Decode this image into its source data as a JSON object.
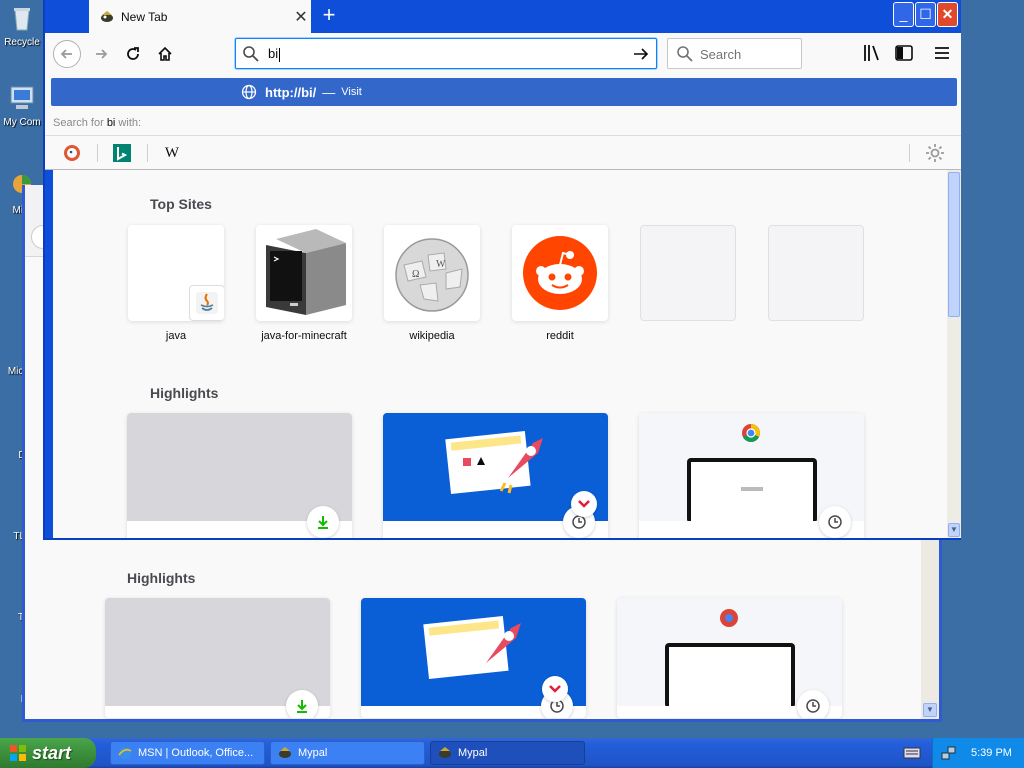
{
  "desktop": {
    "icons": [
      {
        "label": "Recycle"
      },
      {
        "label": "My Com"
      },
      {
        "label": "Micr"
      },
      {
        "label": "Micr E"
      },
      {
        "label": "D"
      },
      {
        "label": "TLa"
      },
      {
        "label": "Tl"
      },
      {
        "label": "I"
      }
    ]
  },
  "browser": {
    "tab_title": "New Tab",
    "url_value": "bi",
    "search_placeholder": "Search",
    "suggestion": {
      "url": "http://bi/",
      "separator": "—",
      "action": "Visit"
    },
    "search_with": {
      "prefix": "Search for ",
      "term": "bi",
      "suffix": " with:"
    },
    "engines": [
      {
        "name": "DuckDuckGo",
        "icon": "duckduckgo-icon"
      },
      {
        "name": "Bing",
        "icon": "bing-icon"
      },
      {
        "name": "Wikipedia",
        "glyph": "W",
        "icon": "wikipedia-icon"
      }
    ]
  },
  "newtab": {
    "top_sites_title": "Top Sites",
    "top_sites": [
      {
        "label": "java"
      },
      {
        "label": "java-for-minecraft"
      },
      {
        "label": "wikipedia"
      },
      {
        "label": "reddit"
      },
      {
        "label": ""
      },
      {
        "label": ""
      }
    ],
    "highlights_title": "Highlights"
  },
  "background_window": {
    "highlights_title": "Highlights"
  },
  "taskbar": {
    "start_label": "start",
    "items": [
      {
        "label": "MSN | Outlook, Office..."
      },
      {
        "label": "Mypal"
      },
      {
        "label": "Mypal"
      }
    ],
    "clock": "5:39 PM"
  },
  "colors": {
    "desktop": "#3a6ea5",
    "titlebar": "#0f4ed8",
    "suggestion_highlight": "#3367c9",
    "reddit": "#ff4500",
    "highlight_blue": "#0a5fd6"
  }
}
